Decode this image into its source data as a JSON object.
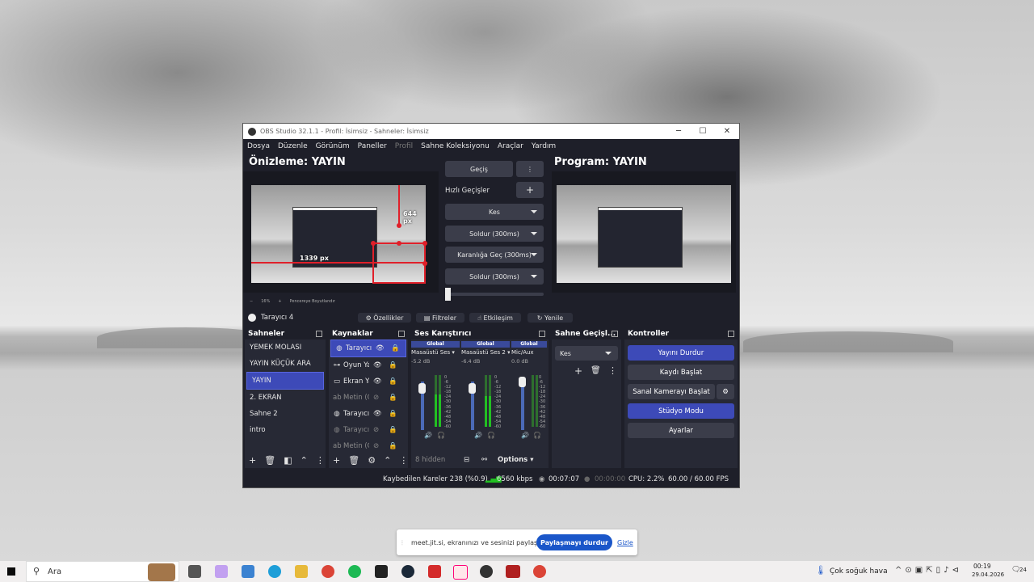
{
  "window": {
    "title": "OBS Studio 32.1.1 - Profil: İsimsiz - Sahneler: İsimsiz",
    "controls": {
      "minimize": "─",
      "maximize": "☐",
      "close": "✕"
    }
  },
  "menu": [
    "Dosya",
    "Düzenle",
    "Görünüm",
    "Paneller",
    "Profil",
    "Sahne Koleksiyonu",
    "Araçlar",
    "Yardım"
  ],
  "preview": {
    "title": "Önizleme: YAYIN",
    "measure_h": "644 px",
    "measure_w": "1339 px",
    "zoom": "16%",
    "zoom_minus": "−",
    "zoom_plus": "+",
    "fit_label": "Pencereye Boyutlandır"
  },
  "program": {
    "title": "Program: YAYIN"
  },
  "transitions": {
    "main": "Geçiş",
    "quick_label": "Hızlı Geçişler",
    "add": "+",
    "menu": "⋮",
    "items": [
      "Kes",
      "Soldur (300ms)",
      "Karanlığa Geç (300ms)",
      "Soldur (300ms)"
    ]
  },
  "source_bar": {
    "name": "Tarayıcı 4",
    "properties": "Özellikler",
    "filters": "Filtreler",
    "interact": "Etkileşim",
    "refresh": "Yenile"
  },
  "scenes": {
    "title": "Sahneler",
    "items": [
      "YEMEK MOLASI",
      "YAYIN KÜÇÜK ARA",
      "YAYIN",
      "2. EKRAN",
      "Sahne 2",
      "intro"
    ],
    "selected_index": 2
  },
  "sources": {
    "title": "Kaynaklar",
    "items": [
      {
        "icon": "globe-icon",
        "label": "Tarayıcı",
        "visible": true,
        "selected": true
      },
      {
        "icon": "gamepad-icon",
        "label": "Oyun Ya",
        "visible": true,
        "selected": false
      },
      {
        "icon": "monitor-icon",
        "label": "Ekran Ya",
        "visible": true,
        "selected": false
      },
      {
        "icon": "text-icon",
        "label": "Metin (G",
        "visible": false,
        "selected": false
      },
      {
        "icon": "globe-icon",
        "label": "Tarayıcı",
        "visible": true,
        "selected": false
      },
      {
        "icon": "globe-icon",
        "label": "Tarayıcı",
        "visible": false,
        "selected": false
      },
      {
        "icon": "text-icon",
        "label": "Metin (G",
        "visible": false,
        "selected": false
      }
    ]
  },
  "mixer": {
    "title": "Ses Karıştırıcı",
    "channels": [
      {
        "global": "Global",
        "name": "Masaüstü Ses",
        "db": "-5.2 dB",
        "level": 0.62
      },
      {
        "global": "Global",
        "name": "Masaüstü Ses 2",
        "db": "-6.4 dB",
        "level": 0.6
      },
      {
        "global": "Global",
        "name": "Mic/Aux",
        "db": "0.0 dB",
        "level": 0.0
      }
    ],
    "scale": [
      "0",
      "-6",
      "-12",
      "-18",
      "-24",
      "-30",
      "-36",
      "-42",
      "-48",
      "-54",
      "-60"
    ],
    "hidden": "8 hidden",
    "options": "Options"
  },
  "scene_transitions": {
    "title": "Sahne Geçişl...",
    "selected": "Kes"
  },
  "controls": {
    "title": "Kontroller",
    "stop_stream": "Yayını Durdur",
    "start_record": "Kaydı Başlat",
    "virtual_cam": "Sanal Kamerayı Başlat",
    "studio_mode": "Stüdyo Modu",
    "settings": "Ayarlar"
  },
  "status": {
    "dropped": "Kaybedilen Kareler 238 (%0.9)",
    "bitrate": "6560 kbps",
    "stream_time": "00:07:07",
    "record_time": "00:00:00",
    "cpu": "CPU: 2.2%",
    "fps": "60.00 / 60.00 FPS"
  },
  "notification": {
    "text": "meet.jit.si, ekranınızı ve sesinizi paylaşıyor.",
    "stop": "Paylaşmayı durdur",
    "hide": "Gizle"
  },
  "taskbar": {
    "search": "Ara",
    "weather": "Çok soğuk hava",
    "time": "00:19",
    "date": "29.04.2026",
    "notif_count": "24"
  },
  "colors": {
    "accent": "#3d4ab8",
    "panel": "#272935",
    "bg": "#1e1f29",
    "selection": "#e0202a",
    "taskbar": "#f1efef"
  }
}
